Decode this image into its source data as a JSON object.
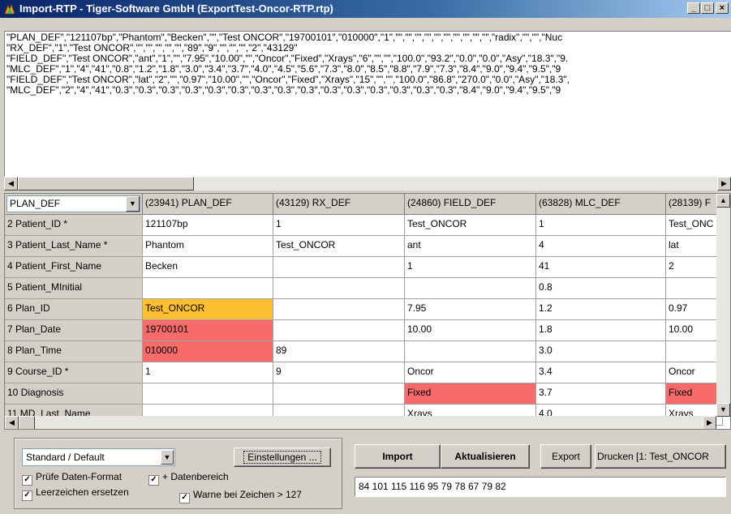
{
  "window": {
    "title": "Import-RTP  -  Tiger-Software GmbH  (ExportTest-Oncor-RTP.rtp)",
    "controls": {
      "minimize": "_",
      "maximize": "□",
      "close": "×"
    }
  },
  "raw_text": {
    "lines": [
      "\"PLAN_DEF\",\"121107bp\",\"Phantom\",\"Becken\",\"\",\"Test ONCOR\",\"19700101\",\"010000\",\"1\",\"\",\"\",\"\",\"\",\"\",\"\",\"\",\"\",\"\",\"\",\"radix\",\"\",\"\",\"Nuc",
      "\"RX_DEF\",\"1\",\"Test ONCOR\",\"\",\"\",\"\",\"\",\"\",\"89\",\"9\",\"\",\"\",\"\",\"2\",\"43129\"",
      "\"FIELD_DEF\",\"Test ONCOR\",\"ant\",\"1\",\"\",\"7.95\",\"10.00\",\"\",\"Oncor\",\"Fixed\",\"Xrays\",\"6\",\"\",\"\",\"100.0\",\"93.2\",\"0.0\",\"0.0\",\"Asy\",\"18.3\",\"9.",
      "\"MLC_DEF\",\"1\",\"4\",\"41\",\"0.8\",\"1.2\",\"1.8\",\"3.0\",\"3.4\",\"3.7\",\"4.0\",\"4.5\",\"5.6\",\"7.3\",\"8.0\",\"8.5\",\"8.8\",\"7.9\",\"7.3\",\"8.4\",\"9.0\",\"9.4\",\"9.5\",\"9",
      "\"FIELD_DEF\",\"Test ONCOR\",\"lat\",\"2\",\"\",\"0.97\",\"10.00\",\"\",\"Oncor\",\"Fixed\",\"Xrays\",\"15\",\"\",\"\",\"100.0\",\"86.8\",\"270.0\",\"0.0\",\"Asy\",\"18.3\",",
      "\"MLC_DEF\",\"2\",\"4\",\"41\",\"0.3\",\"0.3\",\"0.3\",\"0.3\",\"0.3\",\"0.3\",\"0.3\",\"0.3\",\"0.3\",\"0.3\",\"0.3\",\"0.3\",\"0.3\",\"0.3\",\"0.3\",\"8.4\",\"9.0\",\"9.4\",\"9.5\",\"9"
    ]
  },
  "grid": {
    "selector_value": "PLAN_DEF",
    "columns": [
      "(23941) PLAN_DEF",
      "(43129) RX_DEF",
      "(24860) FIELD_DEF",
      "(63828) MLC_DEF",
      "(28139) F"
    ],
    "rows": [
      {
        "label": "2 Patient_ID *",
        "cells": [
          "121107bp",
          "1",
          "Test_ONCOR",
          "1",
          "Test_ONC"
        ]
      },
      {
        "label": "3 Patient_Last_Name *",
        "cells": [
          "Phantom",
          "Test_ONCOR",
          "ant",
          "4",
          "lat"
        ]
      },
      {
        "label": "4 Patient_First_Name",
        "cells": [
          "Becken",
          "",
          "1",
          "41",
          "2"
        ]
      },
      {
        "label": "5 Patient_MInitial",
        "cells": [
          "",
          "",
          "",
          "0.8",
          ""
        ]
      },
      {
        "label": "6 Plan_ID",
        "cells": [
          "Test_ONCOR",
          "",
          "7.95",
          "1.2",
          "0.97"
        ]
      },
      {
        "label": "7 Plan_Date",
        "cells": [
          "19700101",
          "",
          "10.00",
          "1.8",
          "10.00"
        ]
      },
      {
        "label": "8 Plan_Time",
        "cells": [
          "010000",
          "89",
          "",
          "3.0",
          ""
        ]
      },
      {
        "label": "9 Course_ID *",
        "cells": [
          "1",
          "9",
          "Oncor",
          "3.4",
          "Oncor"
        ]
      },
      {
        "label": "10 Diagnosis",
        "cells": [
          "",
          "",
          "Fixed",
          "3.7",
          "Fixed"
        ]
      },
      {
        "label": "11 MD_Last_Name",
        "cells": [
          "",
          "",
          "Xrays",
          "4.0",
          "Xrays"
        ]
      }
    ],
    "highlight_colors": {
      "orange": "#ffbf33",
      "red": "#f76b6b"
    }
  },
  "bottom": {
    "profile_value": "Standard / Default",
    "settings_label": "Einstellungen ...",
    "check_format_label": "Prüfe Daten-Format",
    "data_range_label": "+ Datenbereich",
    "replace_spaces_label": "Leerzeichen ersetzen",
    "warn_label": "Warne bei Zeichen > 127",
    "import_label": "Import",
    "refresh_label": "Aktualisieren",
    "export_label": "Export",
    "print_label": "Drucken [1: Test_ONCOR",
    "output_value": "84 101 115 116 95 79 78 67 79 82"
  }
}
